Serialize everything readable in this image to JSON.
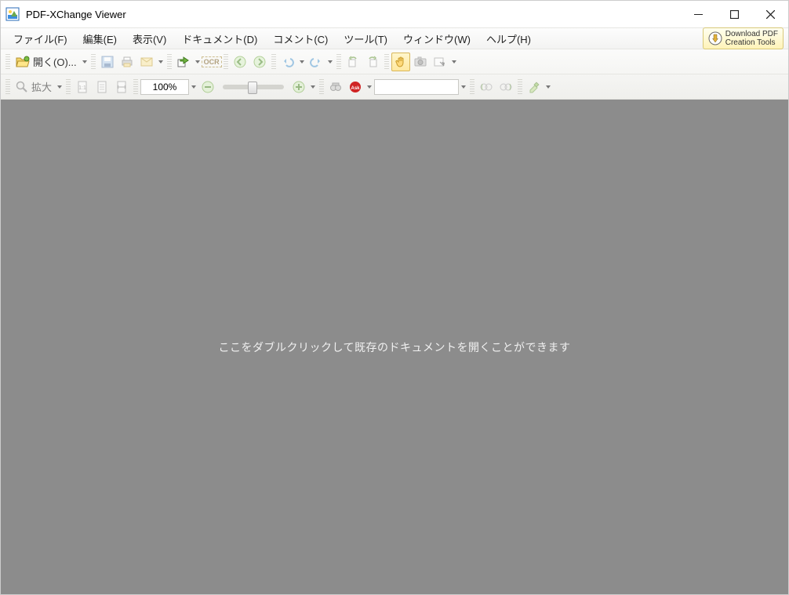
{
  "app": {
    "title": "PDF-XChange Viewer"
  },
  "menu": {
    "file": "ファイル(F)",
    "edit": "編集(E)",
    "view": "表示(V)",
    "document": "ドキュメント(D)",
    "comment": "コメント(C)",
    "tools": "ツール(T)",
    "window": "ウィンドウ(W)",
    "help": "ヘルプ(H)"
  },
  "promo": {
    "line1": "Download PDF",
    "line2": "Creation Tools"
  },
  "toolbar1": {
    "open_label": "開く(O)...",
    "ocr_label": "OCR"
  },
  "toolbar2": {
    "zoom_label": "拡大",
    "zoom_value": "100%",
    "search_value": ""
  },
  "doc": {
    "hint": "ここをダブルクリックして既存のドキュメントを開くことができます"
  }
}
